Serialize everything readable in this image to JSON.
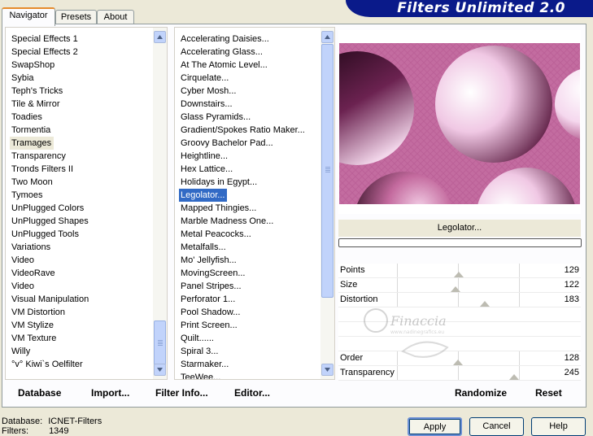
{
  "banner": {
    "title": "Filters Unlimited 2.0"
  },
  "tabs": [
    {
      "label": "Navigator"
    },
    {
      "label": "Presets"
    },
    {
      "label": "About"
    }
  ],
  "categories": [
    "Special Effects 1",
    "Special Effects 2",
    "SwapShop",
    "Sybia",
    "Teph's Tricks",
    "Tile & Mirror",
    "Toadies",
    "Tormentia",
    "Tramages",
    "Transparency",
    "Tronds Filters II",
    "Two Moon",
    "Tymoes",
    "UnPlugged Colors",
    "UnPlugged Shapes",
    "UnPlugged Tools",
    "Variations",
    "Video",
    "VideoRave",
    "Video",
    "Visual Manipulation",
    "VM Distortion",
    "VM Stylize",
    "VM Texture",
    "Willy",
    "°v° Kiwi`s Oelfilter"
  ],
  "categories_selected": "Tramages",
  "filters": [
    "Accelerating Daisies...",
    "Accelerating Glass...",
    "At The Atomic Level...",
    "Cirquelate...",
    "Cyber Mosh...",
    "Downstairs...",
    "Glass Pyramids...",
    "Gradient/Spokes Ratio Maker...",
    "Groovy Bachelor Pad...",
    "Heightline...",
    "Hex Lattice...",
    "Holidays in Egypt...",
    "Legolator...",
    "Mapped Thingies...",
    "Marble Madness One...",
    "Metal Peacocks...",
    "Metalfalls...",
    "Mo' Jellyfish...",
    "MovingScreen...",
    "Panel Stripes...",
    "Perforator 1...",
    "Pool Shadow...",
    "Print Screen...",
    "Quilt......",
    "Spiral 3...",
    "Starmaker...",
    "TeeWee..."
  ],
  "filters_selected": "Legolator...",
  "bottom_links": {
    "database": "Database",
    "import": "Import...",
    "filter_info": "Filter Info...",
    "editor": "Editor..."
  },
  "preview": {
    "filter_name": "Legolator...",
    "progress": 0
  },
  "params": [
    {
      "label": "Points",
      "value": "129",
      "level": 0.506
    },
    {
      "label": "Size",
      "value": "122",
      "level": 0.478
    },
    {
      "label": "Distortion",
      "value": "183",
      "level": 0.718
    },
    {
      "label": "",
      "value": ""
    },
    {
      "label": "",
      "value": ""
    },
    {
      "label": "",
      "value": ""
    },
    {
      "label": "Order",
      "value": "128",
      "level": 0.502
    },
    {
      "label": "Transparency",
      "value": "245",
      "level": 0.961
    }
  ],
  "actions": {
    "randomize": "Randomize",
    "reset": "Reset"
  },
  "status": {
    "database_label": "Database:",
    "database_value": "ICNET-Filters",
    "filters_label": "Filters:",
    "filters_value": "1349"
  },
  "buttons": {
    "apply": "Apply",
    "cancel": "Cancel",
    "help": "Help"
  },
  "watermark": {
    "text": "Finaccia",
    "subtext": "www.nadinegrafics.eu"
  },
  "colors": {
    "accent": "#e68b2c",
    "selection": "#316ac5",
    "banner": "#0a1a8a",
    "preview": "#c65a9a"
  }
}
